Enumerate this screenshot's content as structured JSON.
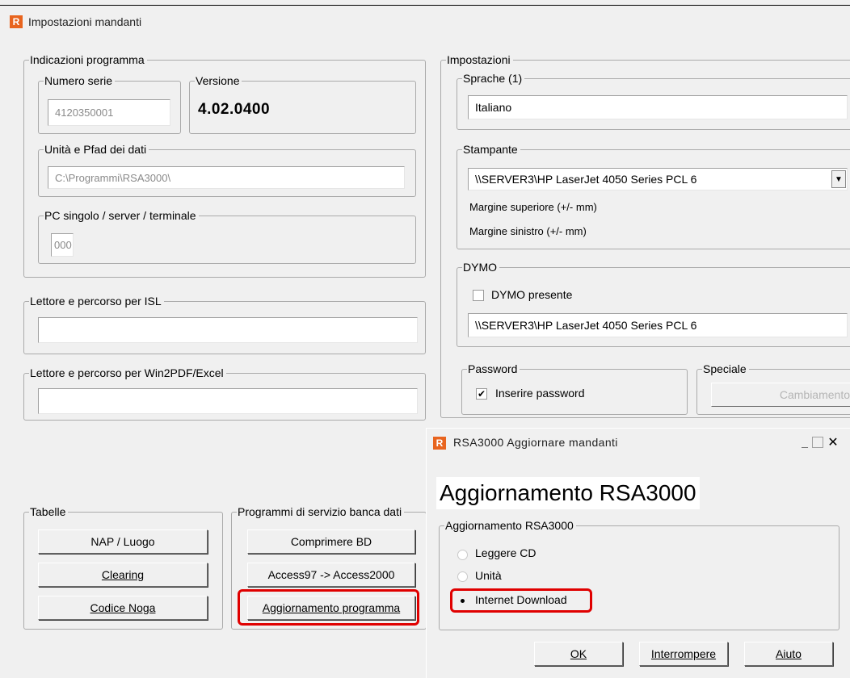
{
  "window": {
    "title": "Impostazioni mandanti"
  },
  "program_info": {
    "group_label": "Indicazioni programma",
    "serial_label": "Numero serie",
    "serial_value": "4120350001",
    "version_label": "Versione",
    "version_value": "4.02.0400",
    "data_path_label": "Unità e Pfad dei dati",
    "data_path_value": "C:\\Programmi\\RSA3000\\",
    "pc_label": "PC singolo / server / terminale",
    "pc_value": "000"
  },
  "isl": {
    "label": "Lettore e percorso per ISL",
    "value": ""
  },
  "win2pdf": {
    "label": "Lettore e percorso per Win2PDF/Excel",
    "value": ""
  },
  "tables": {
    "label": "Tabelle",
    "nap_button": "NAP / Luogo",
    "clearing_button": "Clearing",
    "noga_button": "Codice Noga"
  },
  "db_services": {
    "label": "Programmi di servizio banca dati",
    "compress_button": "Comprimere BD",
    "access_button": "Access97 -> Access2000",
    "update_button": "Aggiornamento programma"
  },
  "settings": {
    "label": "Impostazioni",
    "language_label": "Sprache (1)",
    "language_value": "Italiano",
    "printer_label": "Stampante",
    "printer_value": "\\\\SERVER3\\HP LaserJet 4050 Series PCL 6",
    "margin_top_label": "Margine superiore (+/- mm)",
    "margin_left_label": "Margine sinistro (+/- mm)",
    "dymo_label": "DYMO",
    "dymo_checkbox_label": "DYMO presente",
    "dymo_checked": false,
    "dymo_printer_value": "\\\\SERVER3\\HP LaserJet 4050 Series PCL 6",
    "password_label": "Password",
    "password_checkbox_label": "Inserire password",
    "password_checked": true,
    "special_label": "Speciale",
    "change_button": "Cambiamento"
  },
  "update_dialog": {
    "title": "RSA3000   Aggiornare mandanti",
    "heading": "Aggiornamento RSA3000",
    "group_label": "Aggiornamento RSA3000",
    "options": [
      {
        "label": "Leggere CD",
        "selected": false
      },
      {
        "label": "Unità",
        "selected": false
      },
      {
        "label": "Internet Download",
        "selected": true
      }
    ],
    "ok_button": "OK",
    "cancel_button": "Interrompere",
    "help_button": "Aiuto"
  },
  "colors": {
    "highlight": "#e00000",
    "logo": "#e8641e",
    "window_bg": "#f0f0f0"
  }
}
